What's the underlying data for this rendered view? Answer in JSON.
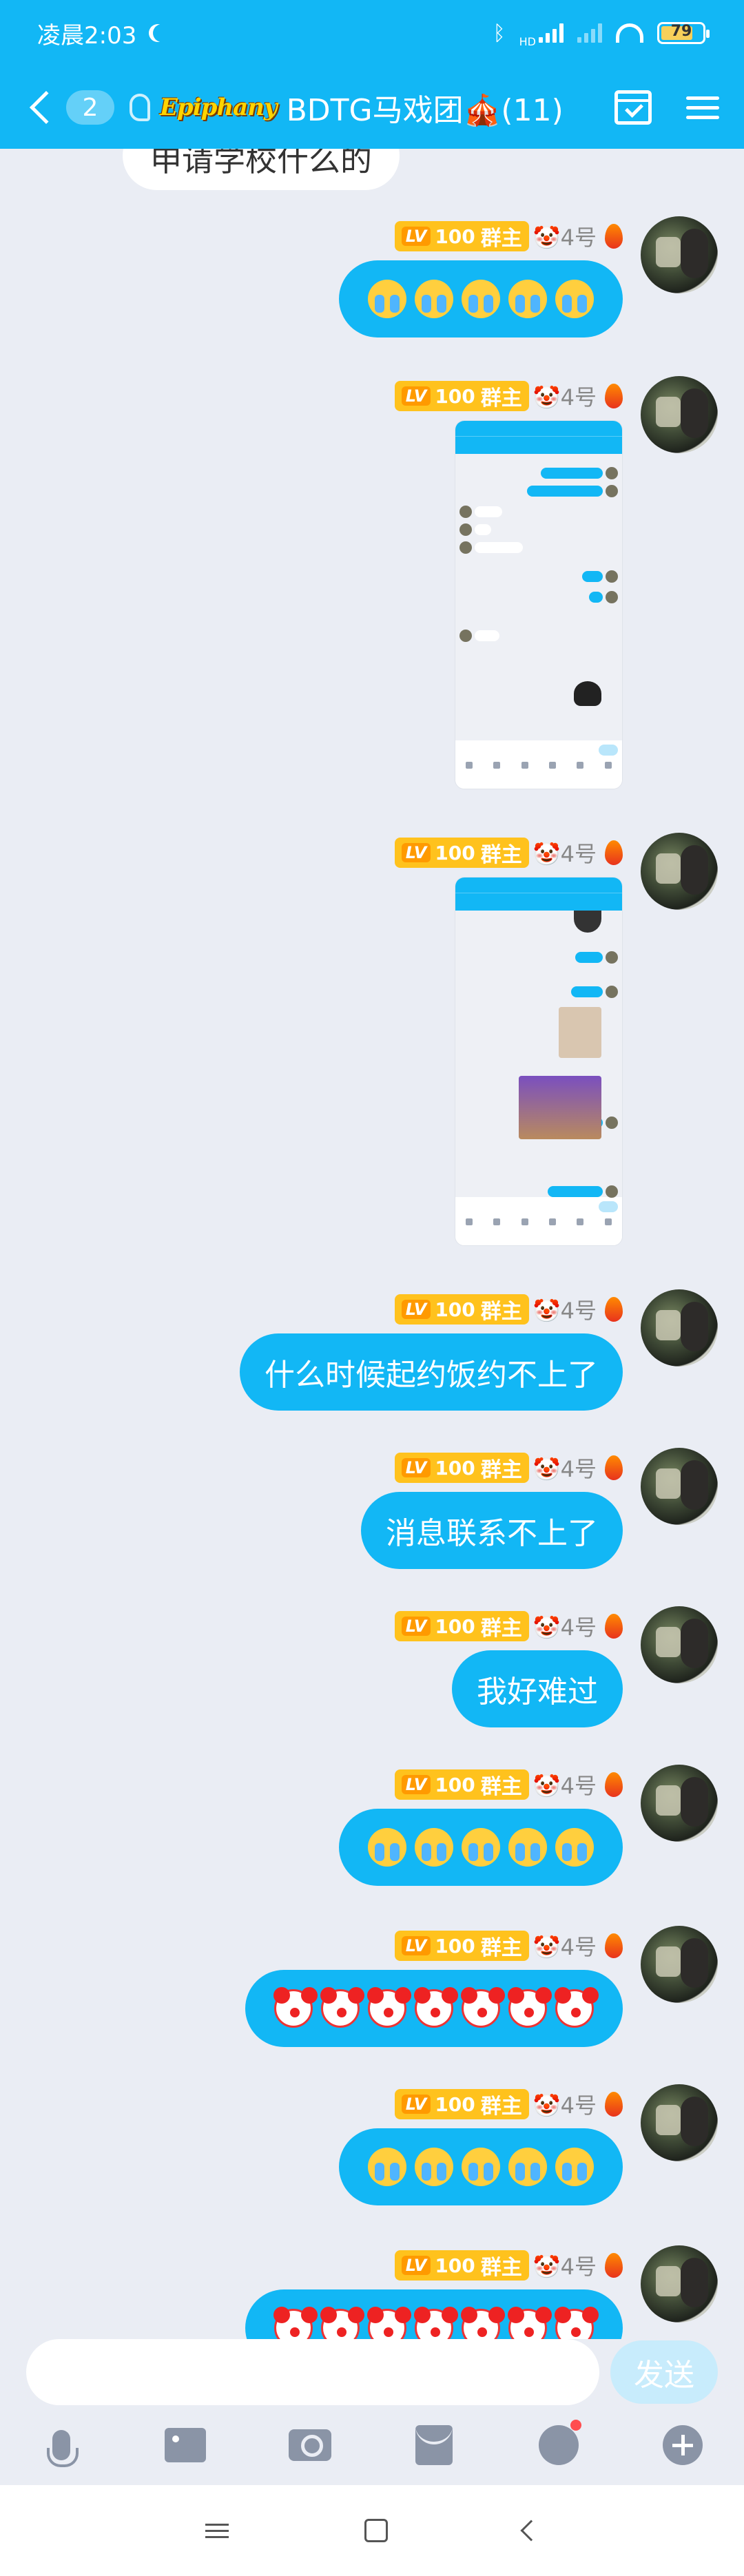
{
  "status_bar": {
    "time": "凌晨2:03",
    "battery": "79",
    "hd_label": "HD"
  },
  "header": {
    "back_count": "2",
    "brand": "Epiphany",
    "group_name": "BDTG马戏团🎪(11)"
  },
  "sender": {
    "level": "LV100",
    "lv_tag": "LV",
    "role": "群主",
    "nickname": "🤡4号"
  },
  "partial_incoming": "申请学校什么的",
  "messages": [
    {
      "type": "emoji",
      "emoji": "cry",
      "count": 5
    },
    {
      "type": "screenshot"
    },
    {
      "type": "screenshot"
    },
    {
      "type": "text",
      "text": "什么时候起约饭约不上了"
    },
    {
      "type": "text",
      "text": "消息联系不上了"
    },
    {
      "type": "text",
      "text": "我好难过"
    },
    {
      "type": "emoji",
      "emoji": "cry",
      "count": 5
    },
    {
      "type": "emoji",
      "emoji": "clown",
      "count": 7
    },
    {
      "type": "emoji",
      "emoji": "cry",
      "count": 5
    },
    {
      "type": "emoji",
      "emoji": "clown",
      "count": 7
    }
  ],
  "input": {
    "placeholder": "",
    "send_label": "发送"
  },
  "toolbar_icons": [
    "mic-icon",
    "image-icon",
    "camera-icon",
    "red-packet-icon",
    "emoji-icon",
    "plus-icon"
  ],
  "colors": {
    "accent": "#12b7f5",
    "background": "#eaedf4",
    "badge_yellow": "#ffc21d"
  }
}
